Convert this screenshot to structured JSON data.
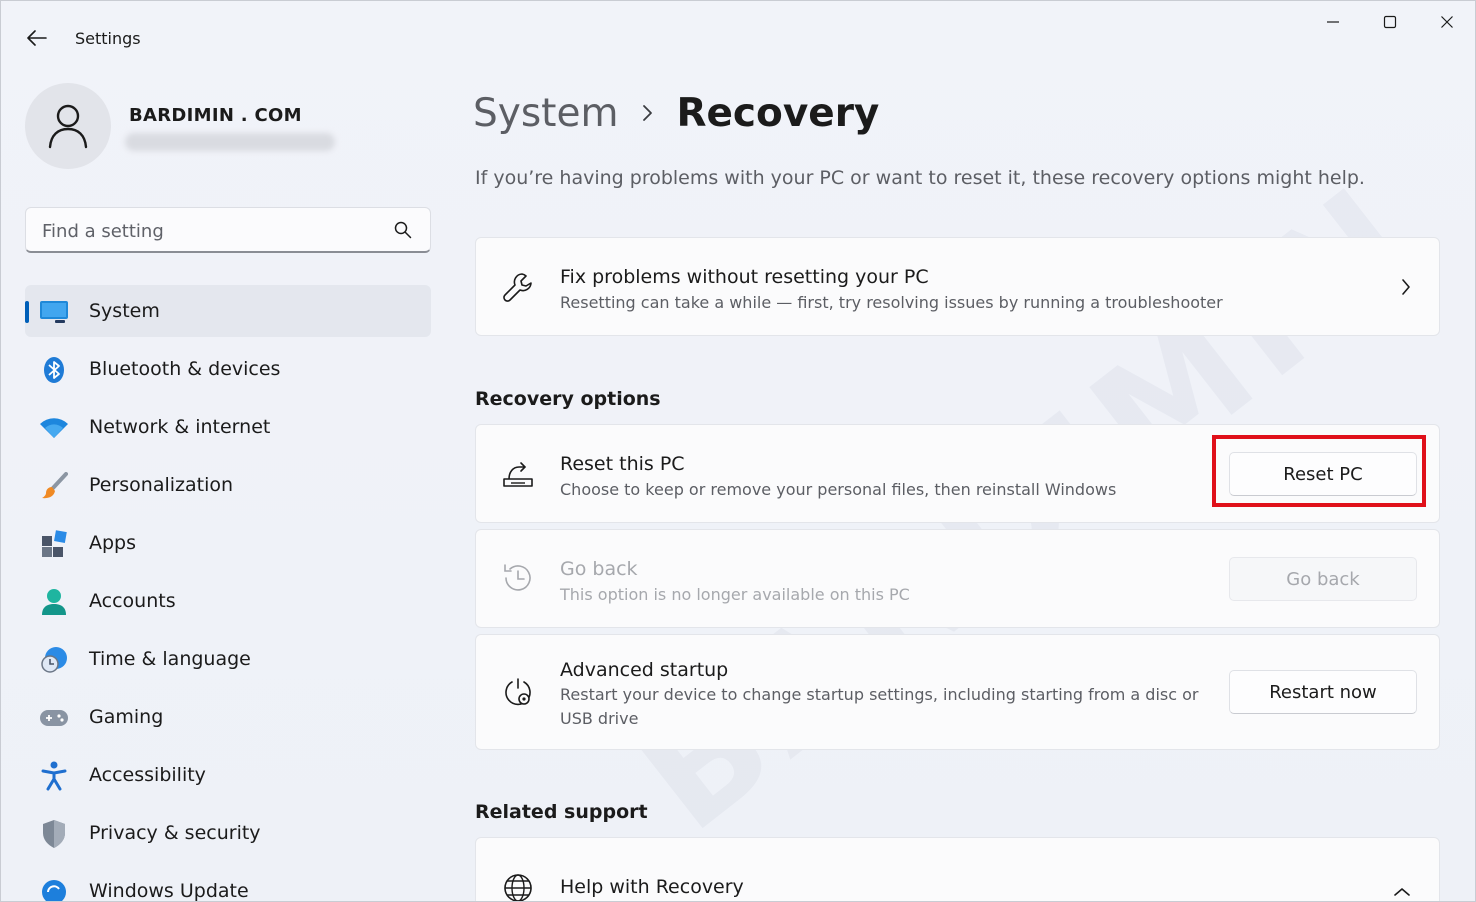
{
  "window": {
    "title": "Settings"
  },
  "profile": {
    "name": "BARDIMIN . COM"
  },
  "search": {
    "placeholder": "Find a setting"
  },
  "sidebar": {
    "items": [
      {
        "label": "System",
        "icon": "system-icon",
        "selected": true
      },
      {
        "label": "Bluetooth & devices",
        "icon": "bluetooth-icon"
      },
      {
        "label": "Network & internet",
        "icon": "wifi-icon"
      },
      {
        "label": "Personalization",
        "icon": "brush-icon"
      },
      {
        "label": "Apps",
        "icon": "apps-icon"
      },
      {
        "label": "Accounts",
        "icon": "person-icon"
      },
      {
        "label": "Time & language",
        "icon": "globe-clock-icon"
      },
      {
        "label": "Gaming",
        "icon": "gamepad-icon"
      },
      {
        "label": "Accessibility",
        "icon": "accessibility-icon"
      },
      {
        "label": "Privacy & security",
        "icon": "shield-icon"
      },
      {
        "label": "Windows Update",
        "icon": "update-icon"
      }
    ]
  },
  "breadcrumb": {
    "parent": "System",
    "current": "Recovery"
  },
  "main": {
    "subtitle": "If you’re having problems with your PC or want to reset it, these recovery options might help.",
    "fix_card": {
      "title": "Fix problems without resetting your PC",
      "desc": "Resetting can take a while — first, try resolving issues by running a troubleshooter"
    },
    "recovery_options_title": "Recovery options",
    "reset_card": {
      "title": "Reset this PC",
      "desc": "Choose to keep or remove your personal files, then reinstall Windows",
      "button": "Reset PC"
    },
    "goback_card": {
      "title": "Go back",
      "desc": "This option is no longer available on this PC",
      "button": "Go back"
    },
    "advanced_card": {
      "title": "Advanced startup",
      "desc": "Restart your device to change startup settings, including starting from a disc or USB drive",
      "button": "Restart now"
    },
    "related_support_title": "Related support",
    "help_card": {
      "title": "Help with Recovery"
    }
  },
  "watermark": {
    "text": "BARDIMIN"
  },
  "colors": {
    "accent": "#005fb8",
    "highlight": "#e0101a"
  }
}
